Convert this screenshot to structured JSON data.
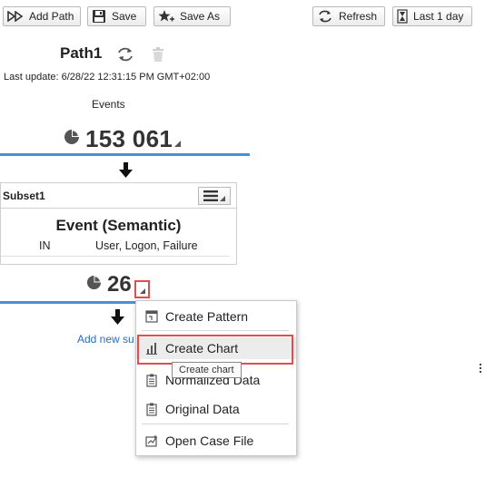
{
  "toolbar": {
    "add_path": "Add Path",
    "save": "Save",
    "save_as": "Save As",
    "refresh": "Refresh",
    "time_range": "Last 1 day"
  },
  "path": {
    "title": "Path1",
    "last_update": "Last update: 6/28/22 12:31:15 PM GMT+02:00",
    "events_label": "Events",
    "event_count": "153 061"
  },
  "subset": {
    "name": "Subset1",
    "event_title": "Event (Semantic)",
    "condition_op": "IN",
    "condition_value": "User, Logon, Failure",
    "count": "26",
    "add_new_label": "Add new su"
  },
  "context_menu": {
    "items": [
      {
        "label": "Create Pattern",
        "icon": "pattern-icon"
      },
      {
        "label": "Create Chart",
        "icon": "bar-chart-icon"
      },
      {
        "label": "Normalized Data",
        "icon": "clipboard-icon"
      },
      {
        "label": "Original Data",
        "icon": "clipboard-icon"
      },
      {
        "label": "Open Case File",
        "icon": "case-file-icon"
      }
    ],
    "tooltip": "Create chart"
  },
  "colors": {
    "accent_blue": "#4a90d9",
    "highlight_red": "#e24d4d",
    "link_blue": "#2a6fb8"
  }
}
